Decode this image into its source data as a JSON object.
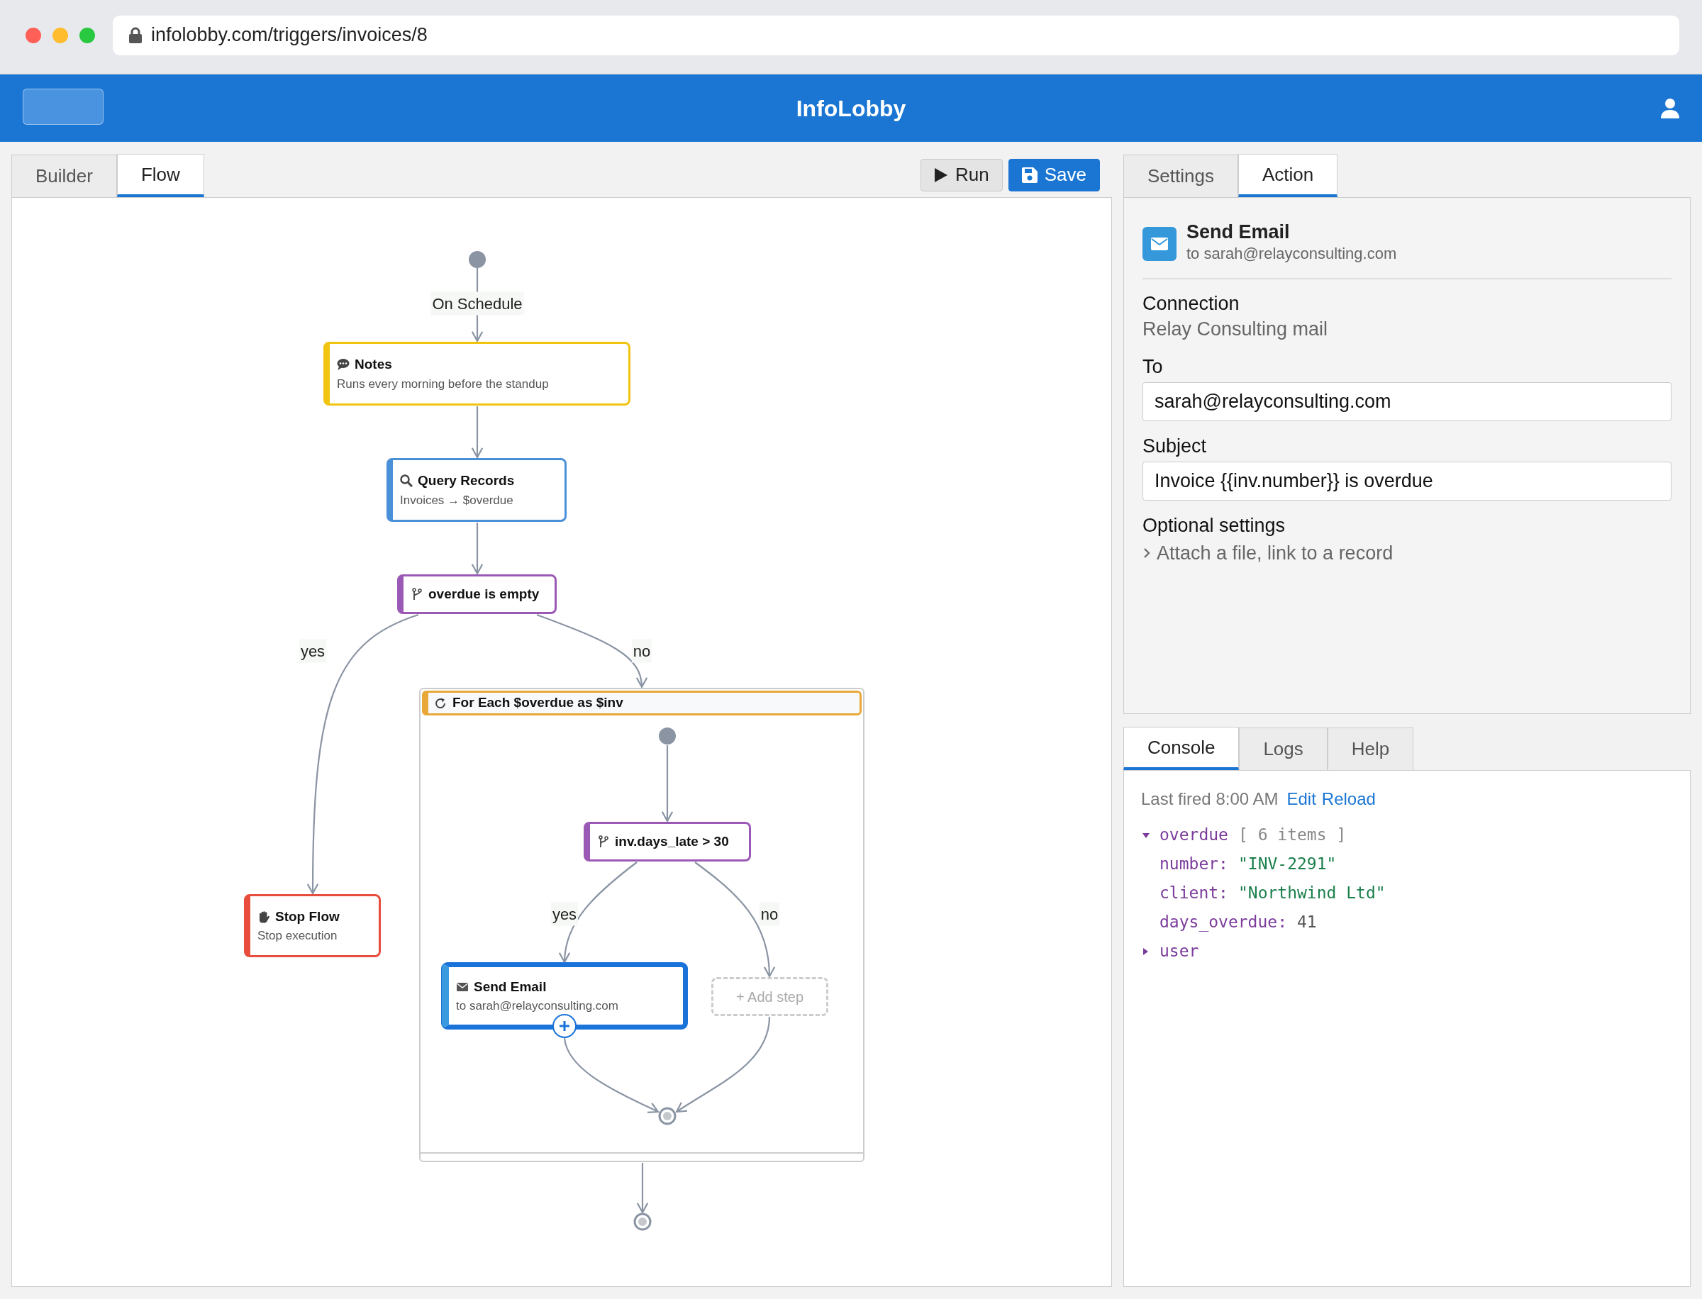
{
  "browser": {
    "url": "infolobby.com/triggers/invoices/8"
  },
  "navbar": {
    "title": "InfoLobby"
  },
  "editor_tabs": [
    {
      "label": "Builder",
      "selected": false
    },
    {
      "label": "Flow",
      "selected": true
    }
  ],
  "toolbar_buttons": [
    {
      "kind": "run",
      "label": "Run"
    },
    {
      "kind": "save",
      "label": "Save"
    }
  ],
  "flow": {
    "trigger": "On Schedule",
    "steps": [
      {
        "kind": "note",
        "title": "Notes",
        "subtitle": "Runs every morning before the standup",
        "selected": false
      },
      {
        "kind": "query",
        "title": "Query Records",
        "subtitle": "Invoices → $overdue",
        "selected": false
      },
      {
        "kind": "condition",
        "title": "overdue is empty",
        "selected": false,
        "branches": [
          {
            "label": "yes",
            "steps": [
              {
                "kind": "stop",
                "title": "Stop Flow",
                "subtitle": "Stop execution",
                "selected": false
              }
            ]
          },
          {
            "label": "no",
            "steps": [
              {
                "kind": "loop",
                "title": "For Each $overdue as $inv",
                "selected": false,
                "steps": [
                  {
                    "kind": "condition",
                    "title": "inv.days_late > 30",
                    "selected": false,
                    "branches": [
                      {
                        "label": "yes",
                        "steps": [
                          {
                            "kind": "action",
                            "title": "Send Email",
                            "subtitle": "to sarah@relayconsulting.com",
                            "selected": true
                          }
                        ]
                      },
                      {
                        "label": "no",
                        "steps": [
                          {
                            "kind": "add",
                            "title": "+ Add step"
                          }
                        ]
                      }
                    ]
                  }
                ]
              }
            ]
          }
        ]
      }
    ]
  },
  "panel_tabs": [
    {
      "label": "Settings",
      "selected": false
    },
    {
      "label": "Action",
      "selected": true
    }
  ],
  "action": {
    "title": "Send Email",
    "subtitle": "to sarah@relayconsulting.com",
    "fields": [
      {
        "kind": "static",
        "label": "Connection",
        "value": "Relay Consulting mail"
      },
      {
        "kind": "input",
        "label": "To",
        "value": "sarah@relayconsulting.com"
      },
      {
        "kind": "input",
        "label": "Subject",
        "value": "Invoice {{inv.number}} is overdue"
      },
      {
        "kind": "collapsible",
        "label": "Optional settings",
        "value": "Attach a file, link to a record",
        "expanded": false
      }
    ]
  },
  "console_tabs": [
    {
      "label": "Console",
      "selected": true
    },
    {
      "label": "Logs",
      "selected": false
    },
    {
      "label": "Help",
      "selected": false
    }
  ],
  "console": {
    "status": "Last fired 8:00 AM",
    "links": [
      "Edit",
      "Reload"
    ],
    "tree": [
      {
        "key": "overdue",
        "summary": "[ 6 items ]",
        "expanded": true,
        "children": [
          {
            "key": "number:",
            "value": "\"INV-2291\"",
            "kind": "string"
          },
          {
            "key": "client:",
            "value": "\"Northwind Ltd\"",
            "kind": "string"
          },
          {
            "key": "days_overdue:",
            "value": "41",
            "kind": "number"
          }
        ]
      },
      {
        "key": "user",
        "expanded": false
      }
    ]
  }
}
